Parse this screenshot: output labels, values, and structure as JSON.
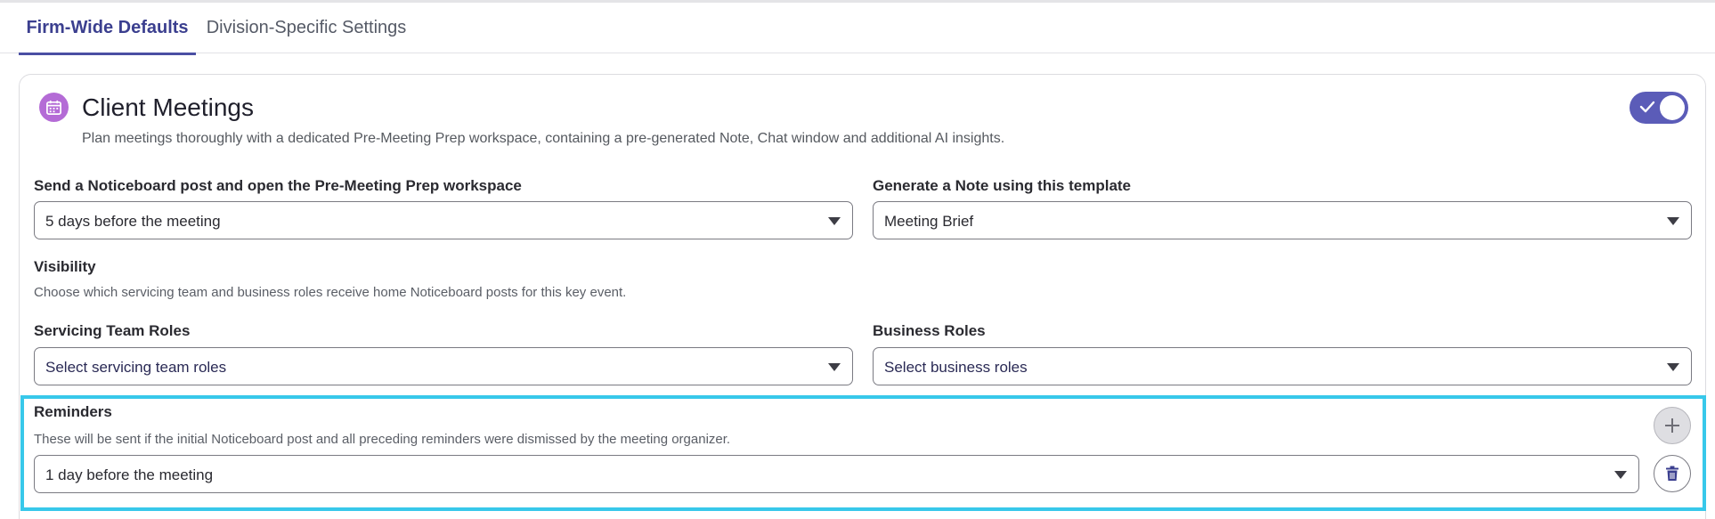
{
  "tabs": [
    {
      "label": "Firm-Wide Defaults",
      "active": true
    },
    {
      "label": "Division-Specific Settings",
      "active": false
    }
  ],
  "card": {
    "icon": "calendar-icon",
    "title": "Client Meetings",
    "description": "Plan meetings thoroughly with a dedicated Pre-Meeting Prep workspace, containing a pre-generated Note, Chat window and additional AI insights.",
    "enabled": true
  },
  "fields": {
    "noticeboard": {
      "label": "Send a Noticeboard post and open the Pre-Meeting Prep workspace",
      "value": "5 days before the meeting"
    },
    "template": {
      "label": "Generate a Note using this template",
      "value": "Meeting Brief"
    }
  },
  "visibility": {
    "heading": "Visibility",
    "hint": "Choose which servicing team and business roles receive home Noticeboard posts for this key event.",
    "servicing": {
      "label": "Servicing Team Roles",
      "placeholder": "Select servicing team roles"
    },
    "business": {
      "label": "Business Roles",
      "placeholder": "Select business roles"
    }
  },
  "reminders": {
    "heading": "Reminders",
    "hint": "These will be sent if the initial Noticeboard post and all preceding reminders were dismissed by the meeting organizer.",
    "items": [
      "1 day before the meeting"
    ]
  },
  "colors": {
    "accent": "#5b5cb8",
    "tab_active": "#3b3f8f",
    "icon_bg": "#b46bd6",
    "highlight": "#38c8ea"
  }
}
